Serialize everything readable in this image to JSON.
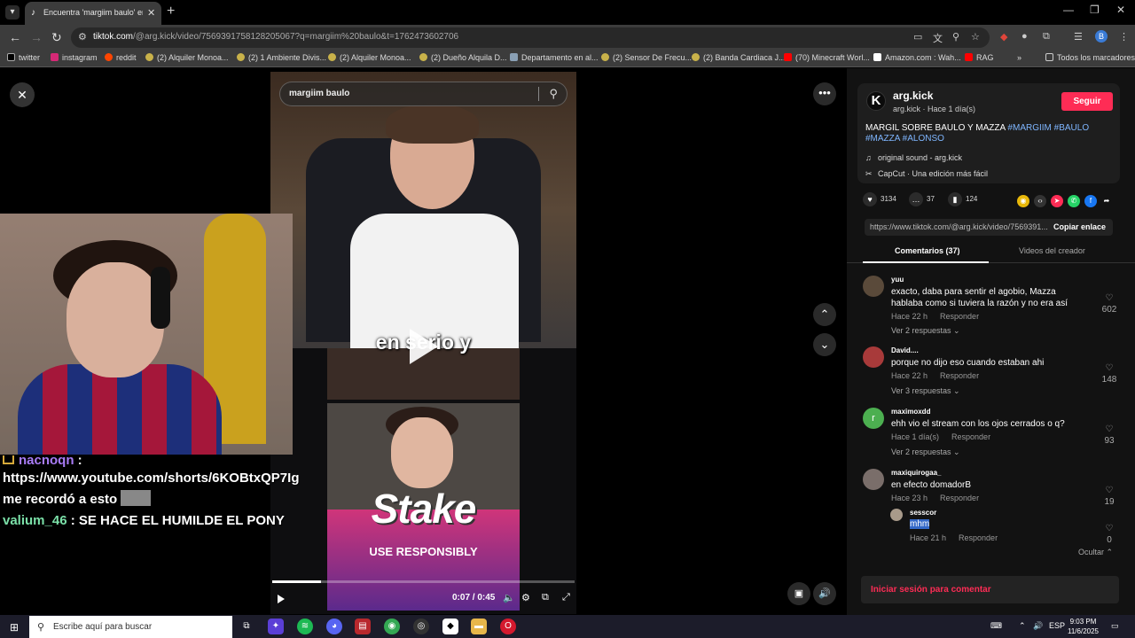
{
  "browser": {
    "tab_title": "Encuentra 'margiim baulo' en TikTok",
    "url_host": "tiktok.com",
    "url_path": "/@arg.kick/video/7569391758128205067?q=margiim%20baulo&t=1762473602706",
    "bookmarks": [
      {
        "label": "twitter",
        "color": "#000000"
      },
      {
        "label": "instagram",
        "color": "#d62976"
      },
      {
        "label": "reddit",
        "color": "#ff4500"
      },
      {
        "label": "(2) Alquiler Monoa...",
        "color": "#c9b24a"
      },
      {
        "label": "(2) 1 Ambiente Divis...",
        "color": "#c9b24a"
      },
      {
        "label": "(2) Alquiler Monoa...",
        "color": "#c9b24a"
      },
      {
        "label": "(2) Dueño Alquila D...",
        "color": "#c9b24a"
      },
      {
        "label": "Departamento en al...",
        "color": "#8aa0b5"
      },
      {
        "label": "(2) Sensor De Frecu...",
        "color": "#c9b24a"
      },
      {
        "label": "(2) Banda Cardiaca J...",
        "color": "#c9b24a"
      },
      {
        "label": "(70) Minecraft Worl...",
        "color": "#ff0000"
      },
      {
        "label": "Amazon.com : Wah...",
        "color": "#ffffff"
      },
      {
        "label": "RAG",
        "color": "#ff0000"
      }
    ],
    "all_bookmarks": "Todos los marcadores"
  },
  "video": {
    "search_text": "margiim baulo",
    "caption": "en serio y",
    "stake_text": "Stake",
    "stake_sub": "USE RESPONSIBLY",
    "time": "0:07 / 0:45",
    "progress": 0.16
  },
  "stream_chat": {
    "line1_user": "nacnoqn",
    "line2": "https://www.youtube.com/shorts/6KOBtxQP7Ig",
    "line3": "me recordó a esto",
    "line4_user": "valium_46",
    "line4_text": ": SE HACE EL HUMILDE EL PONY"
  },
  "author": {
    "name": "arg.kick",
    "sub": "arg.kick · Hace 1 día(s)",
    "follow": "Seguir",
    "desc_text": "MARGIL SOBRE BAULO Y MAZZA",
    "desc_tags": "#MARGIIM #BAULO #MAZZA #ALONSO",
    "sound": "original sound - arg.kick",
    "capcut": "CapCut · Una edición más fácil"
  },
  "stats": {
    "likes": "3134",
    "comments": "37",
    "saves": "124"
  },
  "link": {
    "url": "https://www.tiktok.com/@arg.kick/video/7569391...",
    "copy": "Copiar enlace"
  },
  "tabs": {
    "comments": "Comentarios (37)",
    "creator_videos": "Videos del creador"
  },
  "comments": [
    {
      "user": "yuu",
      "text": "exacto, daba para sentir el agobio, Mazza hablaba como si tuviera la razón y no era así",
      "time": "Hace 22 h",
      "reply": "Responder",
      "replies": "Ver 2 respuestas",
      "likes": "602",
      "color": "#5a4a3a"
    },
    {
      "user": "David....",
      "text": "porque no dijo eso cuando estaban ahi",
      "time": "Hace 22 h",
      "reply": "Responder",
      "replies": "Ver 3 respuestas",
      "likes": "148",
      "color": "#a83a3a"
    },
    {
      "user": "maximoxdd",
      "text": "ehh vio el stream con los ojos cerrados o q?",
      "time": "Hace 1 día(s)",
      "reply": "Responder",
      "replies": "Ver 2 respuestas",
      "likes": "93",
      "color": "#4caf50"
    },
    {
      "user": "maxiquirogaa_",
      "text": "en efecto domadorB",
      "time": "Hace 23 h",
      "reply": "Responder",
      "likes": "19",
      "color": "#7a6e6a"
    }
  ],
  "nested_reply": {
    "user": "sesscor",
    "text": "mhm",
    "time": "Hace 21 h",
    "reply": "Responder",
    "likes": "0"
  },
  "hide": "Ocultar",
  "login": "Iniciar sesión para comentar",
  "taskbar": {
    "search": "Escribe aquí para buscar",
    "lang": "ESP",
    "time": "9:03 PM",
    "date": "11/6/2025"
  }
}
